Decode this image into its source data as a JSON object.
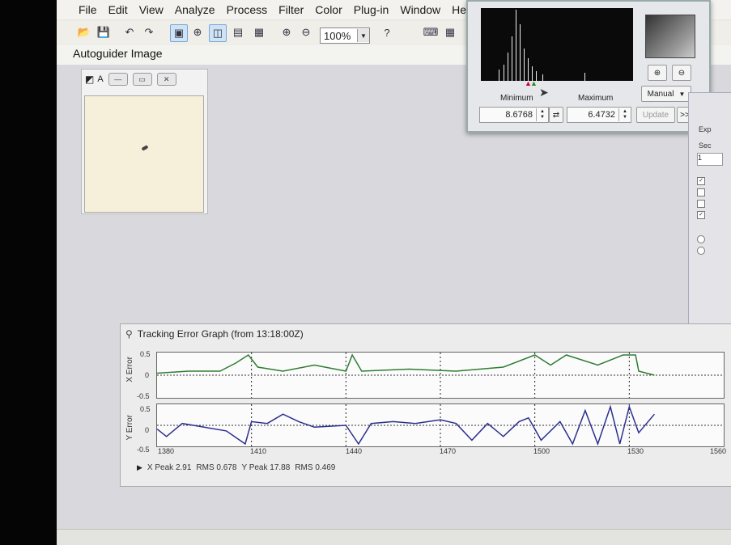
{
  "menu": [
    "File",
    "Edit",
    "View",
    "Analyze",
    "Process",
    "Filter",
    "Color",
    "Plug-in",
    "Window",
    "Help"
  ],
  "toolbar": {
    "zoom": "100%"
  },
  "tab": {
    "label": "Autoguider Image"
  },
  "child_window": {
    "title": "A"
  },
  "histogram": {
    "minimum_label": "Minimum",
    "maximum_label": "Maximum",
    "minimum_value": "8.6768",
    "maximum_value": "6.4732",
    "mode": "Manual",
    "update_label": "Update",
    "expand_label": ">>",
    "zoom_in": "zoom-in-icon",
    "zoom_out": "zoom-out-icon"
  },
  "right_panel": {
    "label1": "Exp",
    "label2": "Sec",
    "value": "1"
  },
  "tracking": {
    "title": "Tracking Error Graph (from 13:18:00Z)",
    "x_axis_label": "X Error",
    "y_axis_label": "Y Error",
    "y_ticks": [
      "0.5",
      "0",
      "-0.5"
    ],
    "x_ticks": [
      "1380",
      "1410",
      "1440",
      "1470",
      "1500",
      "1530",
      "1560"
    ],
    "stats": {
      "x_peak": "X Peak 2.91",
      "x_rms": "RMS 0.678",
      "y_peak": "Y Peak 17.88",
      "y_rms": "RMS 0.469"
    },
    "colors": {
      "x": "#2e7d32",
      "y": "#2b2f8f",
      "grid": "#222"
    },
    "x_error_points": [
      [
        1380,
        0.05
      ],
      [
        1390,
        0.1
      ],
      [
        1400,
        0.1
      ],
      [
        1405,
        0.3
      ],
      [
        1409,
        0.5
      ],
      [
        1412,
        0.2
      ],
      [
        1420,
        0.1
      ],
      [
        1430,
        0.25
      ],
      [
        1440,
        0.1
      ],
      [
        1442,
        0.5
      ],
      [
        1445,
        0.1
      ],
      [
        1460,
        0.15
      ],
      [
        1475,
        0.1
      ],
      [
        1490,
        0.2
      ],
      [
        1500,
        0.5
      ],
      [
        1505,
        0.25
      ],
      [
        1510,
        0.5
      ],
      [
        1520,
        0.25
      ],
      [
        1528,
        0.5
      ],
      [
        1532,
        0.5
      ],
      [
        1533,
        0.1
      ],
      [
        1538,
        0.0
      ]
    ],
    "y_error_points": [
      [
        1380,
        -0.1
      ],
      [
        1383,
        -0.3
      ],
      [
        1388,
        0.05
      ],
      [
        1395,
        -0.05
      ],
      [
        1402,
        -0.15
      ],
      [
        1408,
        -0.5
      ],
      [
        1410,
        0.1
      ],
      [
        1415,
        0.05
      ],
      [
        1420,
        0.3
      ],
      [
        1425,
        0.1
      ],
      [
        1430,
        -0.05
      ],
      [
        1440,
        0.0
      ],
      [
        1444,
        -0.5
      ],
      [
        1448,
        0.05
      ],
      [
        1455,
        0.1
      ],
      [
        1462,
        0.05
      ],
      [
        1470,
        0.15
      ],
      [
        1475,
        0.05
      ],
      [
        1480,
        -0.4
      ],
      [
        1485,
        0.05
      ],
      [
        1490,
        -0.3
      ],
      [
        1495,
        0.1
      ],
      [
        1498,
        0.2
      ],
      [
        1502,
        -0.4
      ],
      [
        1508,
        0.1
      ],
      [
        1512,
        -0.5
      ],
      [
        1516,
        0.4
      ],
      [
        1520,
        -0.5
      ],
      [
        1524,
        0.5
      ],
      [
        1527,
        -0.5
      ],
      [
        1530,
        0.5
      ],
      [
        1533,
        -0.2
      ],
      [
        1538,
        0.3
      ]
    ]
  }
}
